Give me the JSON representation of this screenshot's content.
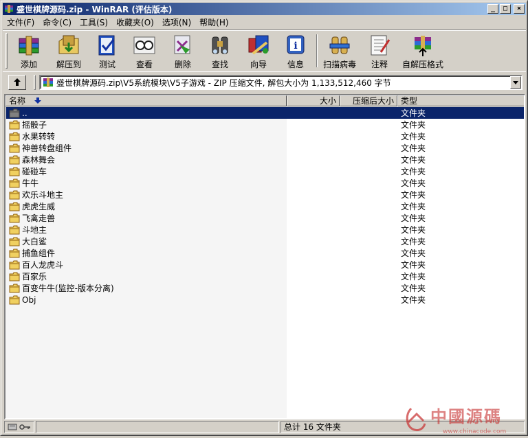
{
  "window": {
    "title": "盛世棋牌源码.zip - WinRAR (评估版本)",
    "controls": [
      "_",
      "□",
      "×"
    ]
  },
  "menu": [
    {
      "label": "文件(F)"
    },
    {
      "label": "命令(C)"
    },
    {
      "label": "工具(S)"
    },
    {
      "label": "收藏夹(O)"
    },
    {
      "label": "选项(N)"
    },
    {
      "label": "帮助(H)"
    }
  ],
  "toolbar": [
    {
      "label": "添加",
      "icon": "add-archive-icon"
    },
    {
      "label": "解压到",
      "icon": "extract-to-icon"
    },
    {
      "label": "测试",
      "icon": "test-icon"
    },
    {
      "label": "查看",
      "icon": "view-icon"
    },
    {
      "label": "删除",
      "icon": "delete-icon"
    },
    {
      "label": "查找",
      "icon": "find-icon"
    },
    {
      "label": "向导",
      "icon": "wizard-icon"
    },
    {
      "label": "信息",
      "icon": "info-icon"
    },
    {
      "label": "扫描病毒",
      "icon": "virus-scan-icon"
    },
    {
      "label": "注释",
      "icon": "comment-icon"
    },
    {
      "label": "自解压格式",
      "icon": "sfx-icon"
    }
  ],
  "address": {
    "path": "盛世棋牌源码.zip\\V5系统模块\\V5子游戏 - ZIP 压缩文件, 解包大小为 1,133,512,460 字节"
  },
  "columns": {
    "name": "名称",
    "size": "大小",
    "packed": "压缩后大小",
    "type": "类型"
  },
  "files": [
    {
      "name": "..",
      "type": "文件夹",
      "selected": true
    },
    {
      "name": "摇骰子",
      "type": "文件夹"
    },
    {
      "name": "水果转转",
      "type": "文件夹"
    },
    {
      "name": "神兽转盘组件",
      "type": "文件夹"
    },
    {
      "name": "森林舞会",
      "type": "文件夹"
    },
    {
      "name": "碰碰车",
      "type": "文件夹"
    },
    {
      "name": "牛牛",
      "type": "文件夹"
    },
    {
      "name": "欢乐斗地主",
      "type": "文件夹"
    },
    {
      "name": "虎虎生威",
      "type": "文件夹"
    },
    {
      "name": "飞禽走兽",
      "type": "文件夹"
    },
    {
      "name": "斗地主",
      "type": "文件夹"
    },
    {
      "name": "大白鲨",
      "type": "文件夹"
    },
    {
      "name": "捕鱼组件",
      "type": "文件夹"
    },
    {
      "name": "百人龙虎斗",
      "type": "文件夹"
    },
    {
      "name": "百家乐",
      "type": "文件夹"
    },
    {
      "name": "百变牛牛(监控-版本分离)",
      "type": "文件夹"
    },
    {
      "name": "Obj",
      "type": "文件夹"
    }
  ],
  "status": {
    "summary": "总计 16 文件夹"
  },
  "watermark": {
    "text": "中國源碼",
    "url": "www.chinacode.com"
  }
}
